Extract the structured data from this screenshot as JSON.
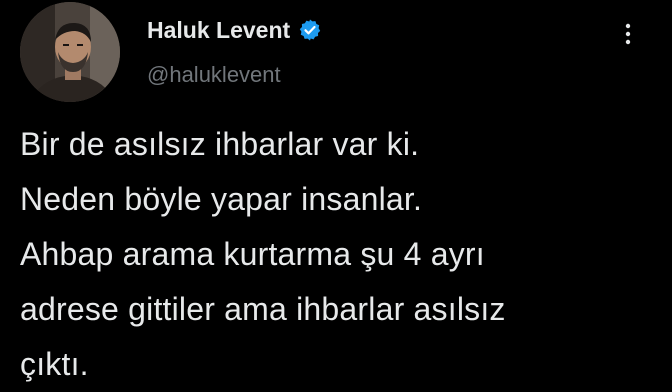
{
  "author": {
    "display_name": "Haluk Levent",
    "handle": "@haluklevent",
    "verified": true,
    "avatar_icon": "profile-photo"
  },
  "tweet": {
    "lines": [
      "Bir de asılsız ihbarlar var ki.",
      "Neden böyle yapar insanlar.",
      "Ahbap arama kurtarma şu 4 ayrı",
      "adrese gittiler ama ihbarlar asılsız",
      "çıktı."
    ]
  },
  "icons": {
    "verified": "verified-badge-icon",
    "more": "more-options-icon"
  },
  "colors": {
    "background": "#000000",
    "text_primary": "#e7e9ea",
    "text_secondary": "#71767b",
    "verified_blue": "#1d9bf0"
  }
}
